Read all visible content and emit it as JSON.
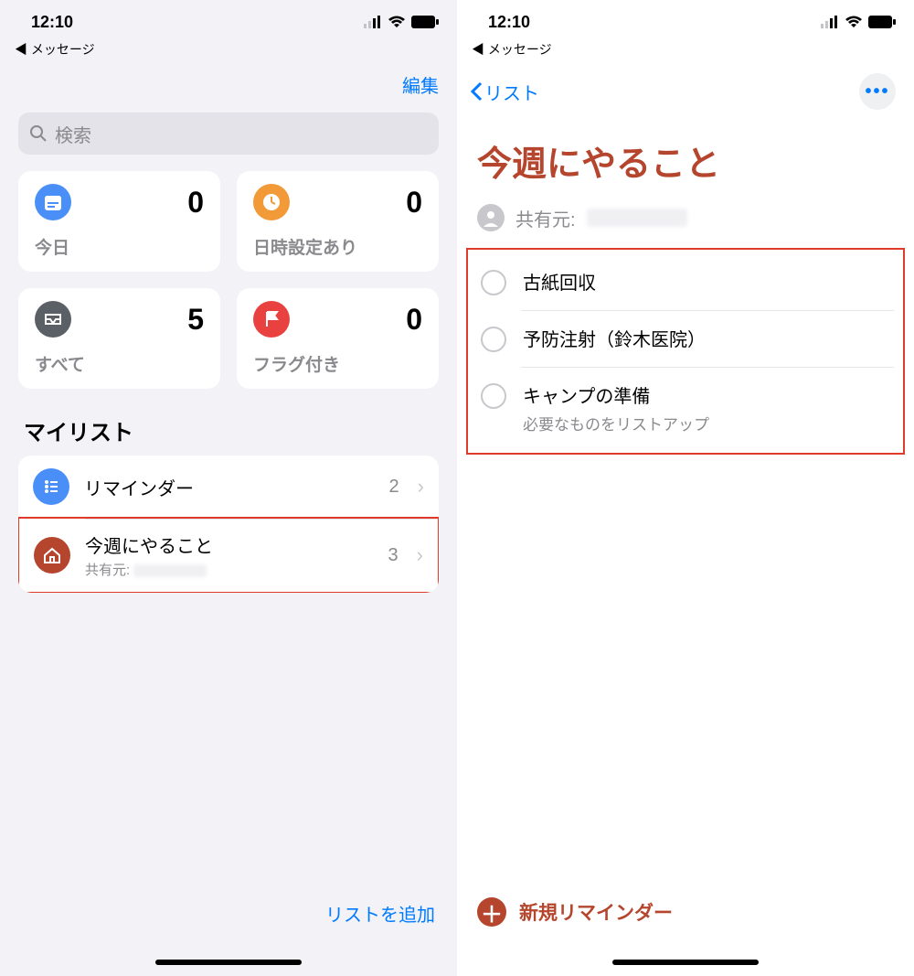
{
  "status": {
    "time": "12:10",
    "back_app": "◀ メッセージ"
  },
  "left": {
    "edit": "編集",
    "search_placeholder": "検索",
    "cards": {
      "today": {
        "label": "今日",
        "count": "0",
        "color": "#4a8ff7"
      },
      "sched": {
        "label": "日時設定あり",
        "count": "0",
        "color": "#f19a37"
      },
      "all": {
        "label": "すべて",
        "count": "5",
        "color": "#5b5f66"
      },
      "flagged": {
        "label": "フラグ付き",
        "count": "0",
        "color": "#e8413f"
      }
    },
    "mylist_header": "マイリスト",
    "lists": [
      {
        "title": "リマインダー",
        "sub": "",
        "count": "2",
        "color": "#4a8ff7"
      },
      {
        "title": "今週にやること",
        "sub": "共有元:",
        "count": "3",
        "color": "#b5452d"
      }
    ],
    "add_list": "リストを追加"
  },
  "right": {
    "back": "リスト",
    "title": "今週にやること",
    "shared_from_label": "共有元:",
    "reminders": [
      {
        "title": "古紙回収",
        "note": ""
      },
      {
        "title": "予防注射（鈴木医院）",
        "note": ""
      },
      {
        "title": "キャンプの準備",
        "note": "必要なものをリストアップ"
      }
    ],
    "new_reminder": "新規リマインダー"
  }
}
